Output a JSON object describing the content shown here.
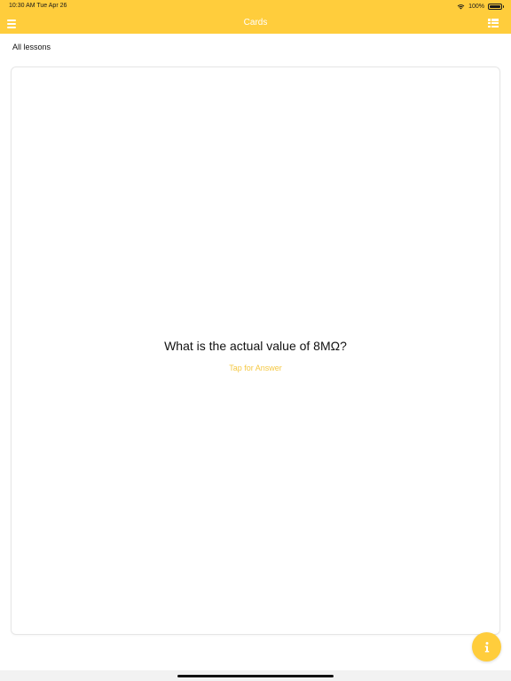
{
  "status_bar": {
    "time": "10:30 AM   Tue Apr 26",
    "battery": "100%",
    "icons": [
      "wifi-icon",
      "battery-icon"
    ]
  },
  "nav_bar": {
    "title": "Cards",
    "left_icon": "hamburger-menu-icon",
    "right_icon": "list-icon"
  },
  "lesson_filter": "All lessons",
  "card": {
    "question": "What is the actual value of 8MΩ?",
    "tap_prompt": "Tap for Answer"
  },
  "info_button": {
    "icon": "info-icon"
  },
  "colors": {
    "accent": "#ffcd3c",
    "tap_prompt": "#f5c842",
    "nav_text": "#ffffff"
  }
}
